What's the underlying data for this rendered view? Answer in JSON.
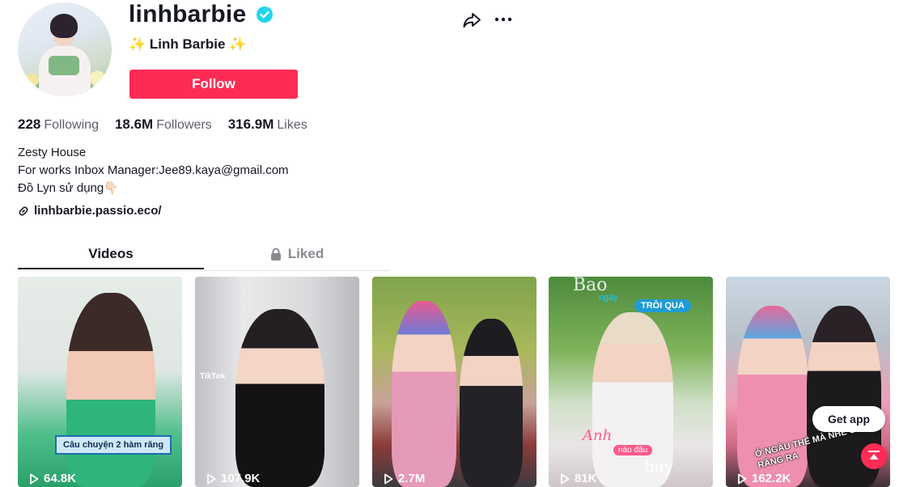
{
  "profile": {
    "username": "linhbarbie",
    "display_name": "✨ Linh Barbie ✨",
    "follow_label": "Follow",
    "verified": true
  },
  "stats": {
    "following_count": "228",
    "following_label": "Following",
    "followers_count": "18.6M",
    "followers_label": "Followers",
    "likes_count": "316.9M",
    "likes_label": "Likes"
  },
  "bio": {
    "line1": "Zesty House",
    "line2": "For works Inbox Manager:Jee89.kaya@gmail.com",
    "line3": "Đồ Lyn sử dụng👇🏻",
    "link": "linhbarbie.passio.eco/"
  },
  "tabs": {
    "videos": "Videos",
    "liked": "Liked"
  },
  "videos": [
    {
      "views": "64.8K",
      "caption": "Câu chuyện 2 hàm răng"
    },
    {
      "views": "107.9K",
      "caption": "TikTok"
    },
    {
      "views": "2.7M"
    },
    {
      "views": "81K",
      "caption_bao": "Bao",
      "caption_ngay": "ngày",
      "caption_troiqua": "TRÔI QUA",
      "caption_anh": "Anh",
      "caption_naodau": "nào đâu",
      "caption_hay": "hay"
    },
    {
      "views": "162.2K",
      "caption": "Ở NGẦU THẾ MÀ NHE CÁI RĂNG RA"
    }
  ],
  "floating": {
    "get_app": "Get app"
  },
  "colors": {
    "accent": "#fe2c55",
    "verified": "#20d5ec"
  }
}
